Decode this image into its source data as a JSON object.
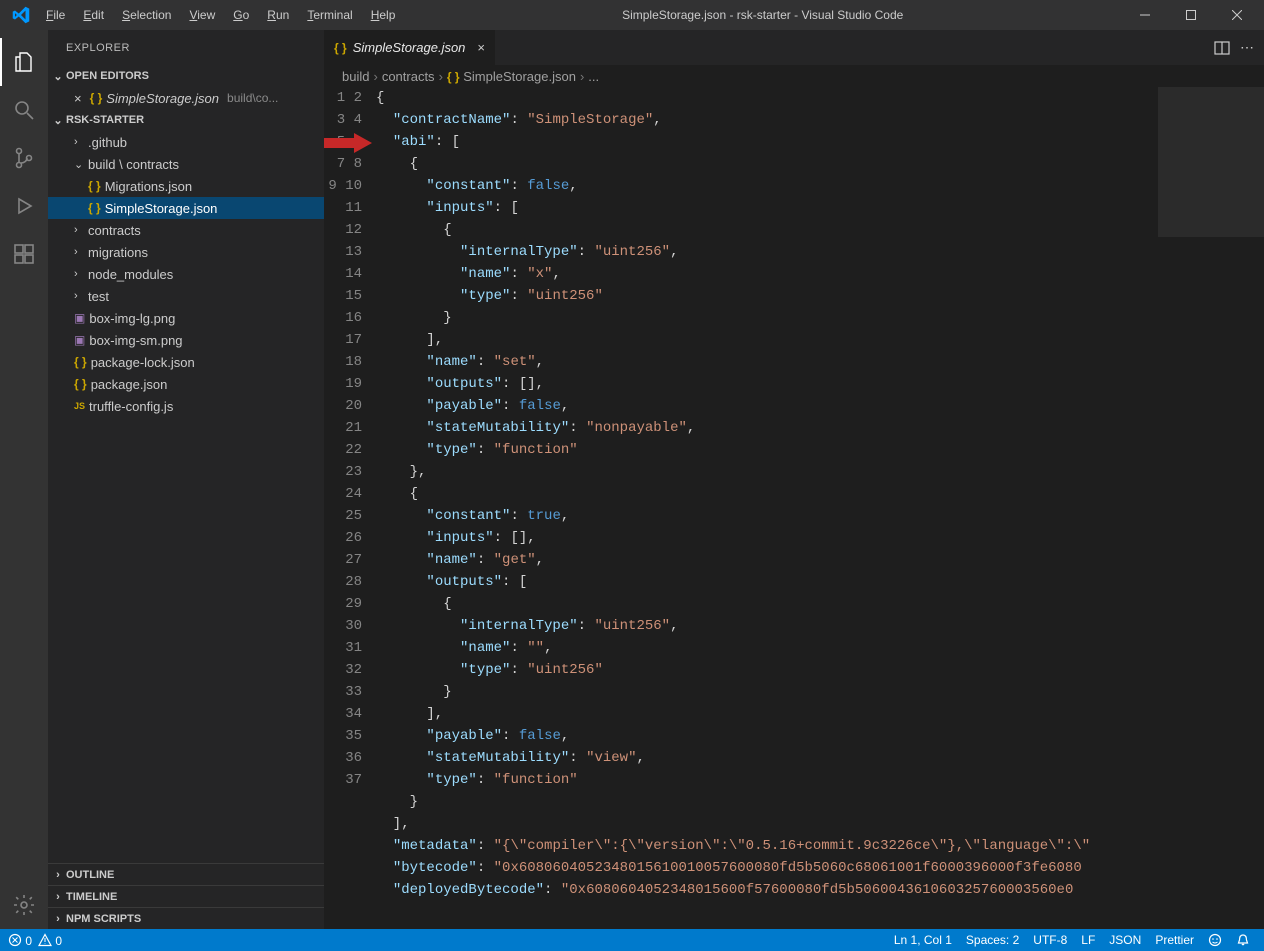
{
  "titlebar": {
    "title": "SimpleStorage.json - rsk-starter - Visual Studio Code",
    "menu": [
      "File",
      "Edit",
      "Selection",
      "View",
      "Go",
      "Run",
      "Terminal",
      "Help"
    ]
  },
  "activitybar": {
    "items": [
      "explorer",
      "search",
      "scm",
      "debug",
      "extensions"
    ],
    "bottom": [
      "settings"
    ]
  },
  "sidebar": {
    "title": "EXPLORER",
    "openEditors": {
      "label": "OPEN EDITORS",
      "items": [
        {
          "name": "SimpleStorage.json",
          "detail": "build\\co..."
        }
      ]
    },
    "workspace": {
      "label": "RSK-STARTER",
      "tree": [
        {
          "type": "folder",
          "expand": false,
          "name": ".github",
          "indent": 1
        },
        {
          "type": "folder",
          "expand": true,
          "name": "build \\ contracts",
          "indent": 1
        },
        {
          "type": "json",
          "name": "Migrations.json",
          "indent": 2
        },
        {
          "type": "json",
          "name": "SimpleStorage.json",
          "indent": 2,
          "selected": true
        },
        {
          "type": "folder",
          "expand": false,
          "name": "contracts",
          "indent": 1
        },
        {
          "type": "folder",
          "expand": false,
          "name": "migrations",
          "indent": 1
        },
        {
          "type": "folder",
          "expand": false,
          "name": "node_modules",
          "indent": 1
        },
        {
          "type": "folder",
          "expand": false,
          "name": "test",
          "indent": 1
        },
        {
          "type": "img",
          "name": "box-img-lg.png",
          "indent": 1
        },
        {
          "type": "img",
          "name": "box-img-sm.png",
          "indent": 1
        },
        {
          "type": "json",
          "name": "package-lock.json",
          "indent": 1
        },
        {
          "type": "json",
          "name": "package.json",
          "indent": 1
        },
        {
          "type": "js",
          "name": "truffle-config.js",
          "indent": 1
        }
      ]
    },
    "bottomSections": [
      "OUTLINE",
      "TIMELINE",
      "NPM SCRIPTS"
    ]
  },
  "editor": {
    "tab": {
      "name": "SimpleStorage.json"
    },
    "breadcrumb": [
      "build",
      "contracts",
      "SimpleStorage.json",
      "..."
    ],
    "lineStart": 1,
    "lineEnd": 37,
    "code": [
      [
        [
          "punc",
          "{"
        ]
      ],
      [
        [
          "punc",
          "  "
        ],
        [
          "key",
          "\"contractName\""
        ],
        [
          "punc",
          ": "
        ],
        [
          "str",
          "\"SimpleStorage\""
        ],
        [
          "punc",
          ","
        ]
      ],
      [
        [
          "punc",
          "  "
        ],
        [
          "key",
          "\"abi\""
        ],
        [
          "punc",
          ": ["
        ]
      ],
      [
        [
          "punc",
          "    {"
        ]
      ],
      [
        [
          "punc",
          "      "
        ],
        [
          "key",
          "\"constant\""
        ],
        [
          "punc",
          ": "
        ],
        [
          "bool",
          "false"
        ],
        [
          "punc",
          ","
        ]
      ],
      [
        [
          "punc",
          "      "
        ],
        [
          "key",
          "\"inputs\""
        ],
        [
          "punc",
          ": ["
        ]
      ],
      [
        [
          "punc",
          "        {"
        ]
      ],
      [
        [
          "punc",
          "          "
        ],
        [
          "key",
          "\"internalType\""
        ],
        [
          "punc",
          ": "
        ],
        [
          "str",
          "\"uint256\""
        ],
        [
          "punc",
          ","
        ]
      ],
      [
        [
          "punc",
          "          "
        ],
        [
          "key",
          "\"name\""
        ],
        [
          "punc",
          ": "
        ],
        [
          "str",
          "\"x\""
        ],
        [
          "punc",
          ","
        ]
      ],
      [
        [
          "punc",
          "          "
        ],
        [
          "key",
          "\"type\""
        ],
        [
          "punc",
          ": "
        ],
        [
          "str",
          "\"uint256\""
        ]
      ],
      [
        [
          "punc",
          "        }"
        ]
      ],
      [
        [
          "punc",
          "      ],"
        ]
      ],
      [
        [
          "punc",
          "      "
        ],
        [
          "key",
          "\"name\""
        ],
        [
          "punc",
          ": "
        ],
        [
          "str",
          "\"set\""
        ],
        [
          "punc",
          ","
        ]
      ],
      [
        [
          "punc",
          "      "
        ],
        [
          "key",
          "\"outputs\""
        ],
        [
          "punc",
          ": [],"
        ]
      ],
      [
        [
          "punc",
          "      "
        ],
        [
          "key",
          "\"payable\""
        ],
        [
          "punc",
          ": "
        ],
        [
          "bool",
          "false"
        ],
        [
          "punc",
          ","
        ]
      ],
      [
        [
          "punc",
          "      "
        ],
        [
          "key",
          "\"stateMutability\""
        ],
        [
          "punc",
          ": "
        ],
        [
          "str",
          "\"nonpayable\""
        ],
        [
          "punc",
          ","
        ]
      ],
      [
        [
          "punc",
          "      "
        ],
        [
          "key",
          "\"type\""
        ],
        [
          "punc",
          ": "
        ],
        [
          "str",
          "\"function\""
        ]
      ],
      [
        [
          "punc",
          "    },"
        ]
      ],
      [
        [
          "punc",
          "    {"
        ]
      ],
      [
        [
          "punc",
          "      "
        ],
        [
          "key",
          "\"constant\""
        ],
        [
          "punc",
          ": "
        ],
        [
          "bool",
          "true"
        ],
        [
          "punc",
          ","
        ]
      ],
      [
        [
          "punc",
          "      "
        ],
        [
          "key",
          "\"inputs\""
        ],
        [
          "punc",
          ": [],"
        ]
      ],
      [
        [
          "punc",
          "      "
        ],
        [
          "key",
          "\"name\""
        ],
        [
          "punc",
          ": "
        ],
        [
          "str",
          "\"get\""
        ],
        [
          "punc",
          ","
        ]
      ],
      [
        [
          "punc",
          "      "
        ],
        [
          "key",
          "\"outputs\""
        ],
        [
          "punc",
          ": ["
        ]
      ],
      [
        [
          "punc",
          "        {"
        ]
      ],
      [
        [
          "punc",
          "          "
        ],
        [
          "key",
          "\"internalType\""
        ],
        [
          "punc",
          ": "
        ],
        [
          "str",
          "\"uint256\""
        ],
        [
          "punc",
          ","
        ]
      ],
      [
        [
          "punc",
          "          "
        ],
        [
          "key",
          "\"name\""
        ],
        [
          "punc",
          ": "
        ],
        [
          "str",
          "\"\""
        ],
        [
          "punc",
          ","
        ]
      ],
      [
        [
          "punc",
          "          "
        ],
        [
          "key",
          "\"type\""
        ],
        [
          "punc",
          ": "
        ],
        [
          "str",
          "\"uint256\""
        ]
      ],
      [
        [
          "punc",
          "        }"
        ]
      ],
      [
        [
          "punc",
          "      ],"
        ]
      ],
      [
        [
          "punc",
          "      "
        ],
        [
          "key",
          "\"payable\""
        ],
        [
          "punc",
          ": "
        ],
        [
          "bool",
          "false"
        ],
        [
          "punc",
          ","
        ]
      ],
      [
        [
          "punc",
          "      "
        ],
        [
          "key",
          "\"stateMutability\""
        ],
        [
          "punc",
          ": "
        ],
        [
          "str",
          "\"view\""
        ],
        [
          "punc",
          ","
        ]
      ],
      [
        [
          "punc",
          "      "
        ],
        [
          "key",
          "\"type\""
        ],
        [
          "punc",
          ": "
        ],
        [
          "str",
          "\"function\""
        ]
      ],
      [
        [
          "punc",
          "    }"
        ]
      ],
      [
        [
          "punc",
          "  ],"
        ]
      ],
      [
        [
          "punc",
          "  "
        ],
        [
          "key",
          "\"metadata\""
        ],
        [
          "punc",
          ": "
        ],
        [
          "str",
          "\"{\\\"compiler\\\":{\\\"version\\\":\\\"0.5.16+commit.9c3226ce\\\"},\\\"language\\\":\\\""
        ]
      ],
      [
        [
          "punc",
          "  "
        ],
        [
          "key",
          "\"bytecode\""
        ],
        [
          "punc",
          ": "
        ],
        [
          "str",
          "\"0x6080604052348015610010057600080fd5b5060c68061001f6000396000f3fe6080"
        ]
      ],
      [
        [
          "punc",
          "  "
        ],
        [
          "key",
          "\"deployedBytecode\""
        ],
        [
          "punc",
          ": "
        ],
        [
          "str",
          "\"0x6080604052348015600f57600080fd5b506004361060325760003560e0"
        ]
      ]
    ]
  },
  "statusbar": {
    "errors": "0",
    "warnings": "0",
    "right": [
      "Ln 1, Col 1",
      "Spaces: 2",
      "UTF-8",
      "LF",
      "JSON",
      "Prettier"
    ]
  }
}
